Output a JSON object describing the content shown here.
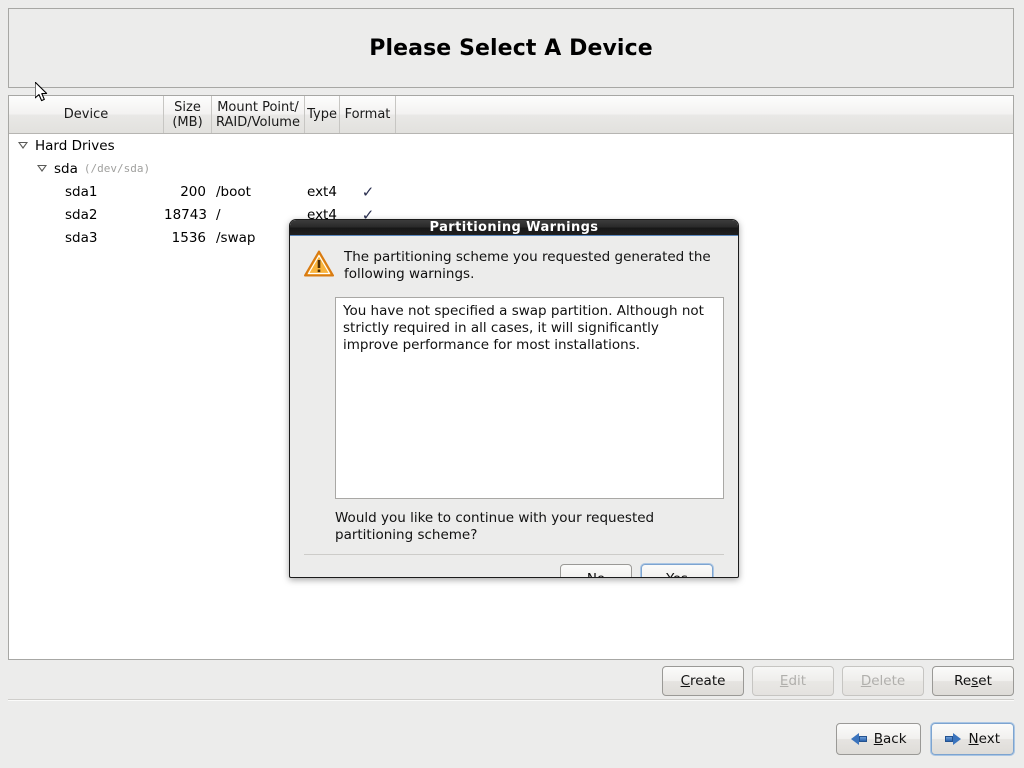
{
  "header": {
    "title": "Please Select A Device"
  },
  "table": {
    "columns": [
      {
        "label": "Device"
      },
      {
        "label": "Size\n(MB)",
        "line1": "Size",
        "line2": "(MB)"
      },
      {
        "label": "Mount Point/\nRAID/Volume",
        "line1": "Mount Point/",
        "line2": "RAID/Volume"
      },
      {
        "label": "Type"
      },
      {
        "label": "Format"
      }
    ],
    "rows": [
      {
        "device": "Hard Drives",
        "devpath": "",
        "size": "",
        "mount": "",
        "type": "",
        "format": "",
        "level": 1,
        "expander": true
      },
      {
        "device": "sda",
        "devpath": "(/dev/sda)",
        "size": "",
        "mount": "",
        "type": "",
        "format": "",
        "level": 2,
        "expander": true
      },
      {
        "device": "sda1",
        "devpath": "",
        "size": "200",
        "mount": "/boot",
        "type": "ext4",
        "format": "✓",
        "level": 3,
        "expander": false
      },
      {
        "device": "sda2",
        "devpath": "",
        "size": "18743",
        "mount": "/",
        "type": "ext4",
        "format": "✓",
        "level": 3,
        "expander": false
      },
      {
        "device": "sda3",
        "devpath": "",
        "size": "1536",
        "mount": "/swap",
        "type": "",
        "format": "",
        "level": 3,
        "expander": false
      }
    ]
  },
  "actions": {
    "create": {
      "pre": "",
      "mnemonic": "C",
      "post": "reate",
      "enabled": true
    },
    "edit": {
      "pre": "",
      "mnemonic": "E",
      "post": "dit",
      "enabled": false
    },
    "delete": {
      "pre": "",
      "mnemonic": "D",
      "post": "elete",
      "enabled": false
    },
    "reset": {
      "pre": "Re",
      "mnemonic": "s",
      "post": "et",
      "enabled": true
    }
  },
  "nav": {
    "back": {
      "pre": "",
      "mnemonic": "B",
      "post": "ack",
      "icon": "arrow-left-icon"
    },
    "next": {
      "pre": "",
      "mnemonic": "N",
      "post": "ext",
      "icon": "arrow-right-icon",
      "focused": true
    }
  },
  "dialog": {
    "title": "Partitioning Warnings",
    "icon": "warning-triangle-icon",
    "message": "The partitioning scheme you requested generated the following warnings.",
    "warnings_text": "You have not specified a swap partition.  Although not strictly required in all cases, it will significantly improve performance for most installations.",
    "question": "Would you like to continue with your requested partitioning scheme?",
    "buttons": {
      "no": {
        "pre": "",
        "mnemonic": "N",
        "post": "o",
        "focused": false
      },
      "yes": {
        "pre": "",
        "mnemonic": "Y",
        "post": "es",
        "focused": true
      }
    }
  },
  "colors": {
    "window_bg": "#ececeb",
    "panel_border": "#a7a7a4",
    "titlebar_bg": "#1f1f1f",
    "accent_blue": "#3b74bd",
    "focus_blue": "#7da4d0",
    "warning_orange": "#f0911e",
    "check_navy": "#2b3050",
    "muted_text": "#a0a09e"
  }
}
